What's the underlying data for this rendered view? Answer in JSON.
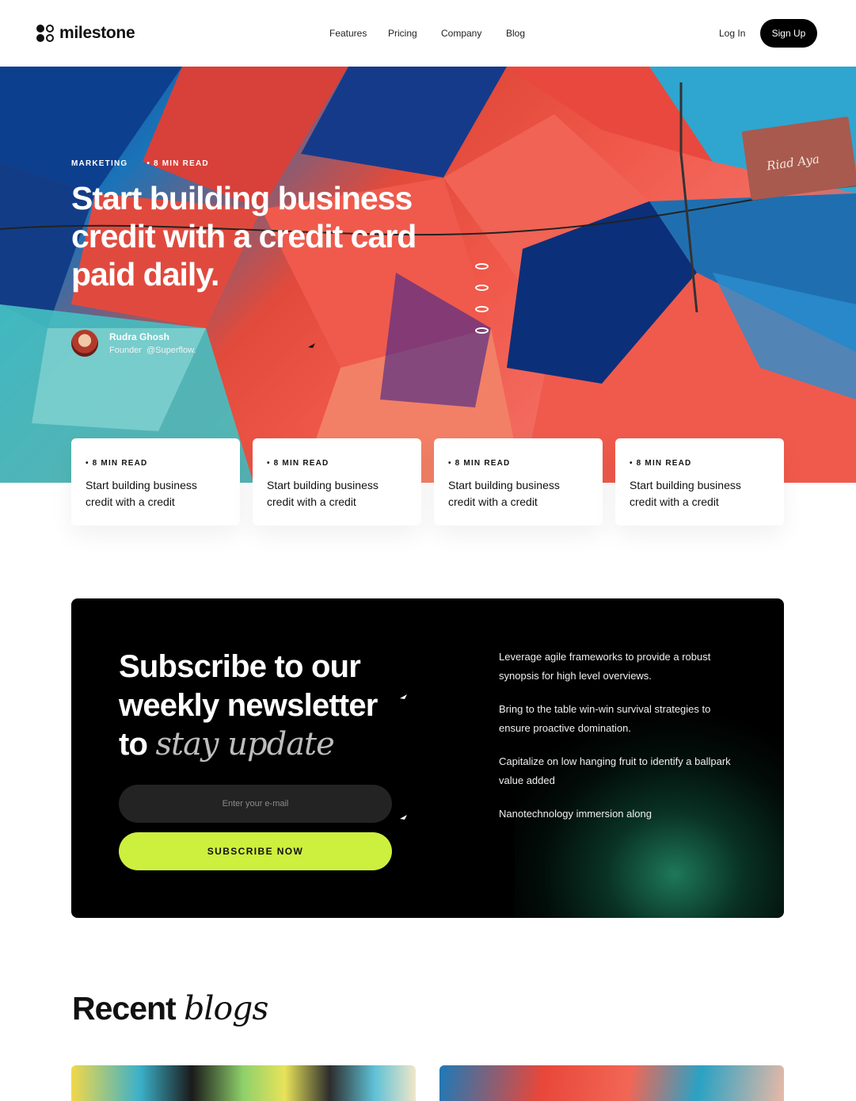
{
  "header": {
    "brand": "milestone",
    "nav": [
      "Features",
      "Pricing",
      "Company",
      "Blog"
    ],
    "login_label": "Log In",
    "signup_label": "Sign Up"
  },
  "hero": {
    "category": "MARKETING",
    "read_time": "• 8 MIN READ",
    "title": "Start building business credit with a credit card paid daily.",
    "author": {
      "name": "Rudra Ghosh",
      "role": "Founder",
      "handle": "@Superflow."
    },
    "sign": {
      "line1": "Riad Aya"
    }
  },
  "cards": [
    {
      "meta": "• 8 MIN READ",
      "title": "Start building business credit with a credit"
    },
    {
      "meta": "• 8 MIN READ",
      "title": "Start building business credit with a credit"
    },
    {
      "meta": "• 8 MIN READ",
      "title": "Start building business credit with a credit"
    },
    {
      "meta": "• 8 MIN READ",
      "title": "Start building business credit with a credit"
    }
  ],
  "newsletter": {
    "title_part1": "Subscribe to our weekly newsletter to ",
    "title_em": "stay update",
    "email_placeholder": "Enter your e-mail",
    "button_label": "SUBSCRIBE NOW",
    "points": [
      "Leverage agile frameworks to provide a robust synopsis for high level overviews.",
      "Bring to the table win-win survival strategies to ensure proactive domination.",
      "Capitalize on low hanging fruit to identify a ballpark value added",
      "Nanotechnology immersion along"
    ]
  },
  "recent": {
    "title_part1": "Recent ",
    "title_em": "blogs"
  },
  "colors": {
    "accent": "#cdef3e",
    "dark": "#000000",
    "input_bg": "#232323"
  }
}
